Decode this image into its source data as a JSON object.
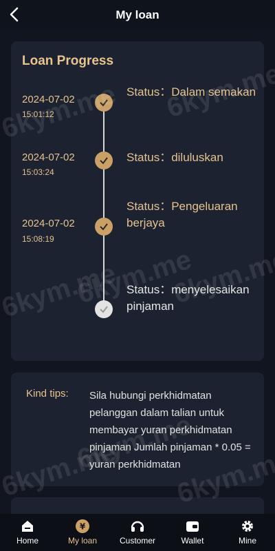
{
  "header": {
    "title": "My loan"
  },
  "progress": {
    "title": "Loan Progress",
    "steps": [
      {
        "date": "2024-07-02",
        "time": "15:01:12",
        "status": "Status：Dalam semakan",
        "done": true
      },
      {
        "date": "2024-07-02",
        "time": "15:03:24",
        "status": "Status：diluluskan",
        "done": true
      },
      {
        "date": "2024-07-02",
        "time": "15:08:19",
        "status": "Status：Pengeluaran berjaya",
        "done": true
      },
      {
        "date": "",
        "time": "",
        "status": "Status：menyelesaikan pinjaman",
        "done": false
      }
    ]
  },
  "tips": {
    "label": "Kind tips:",
    "text": "Sila hubungi perkhidmatan pelanggan dalam talian untuk membayar yuran perkhidmatan pinjaman Jumlah pinjaman * 0.05 = yuran perkhidmatan"
  },
  "nav": {
    "items": [
      {
        "label": "Home",
        "icon": "home-icon"
      },
      {
        "label": "My loan",
        "icon": "loan-icon"
      },
      {
        "label": "Customer",
        "icon": "headset-icon"
      },
      {
        "label": "Wallet",
        "icon": "wallet-icon"
      },
      {
        "label": "Mine",
        "icon": "gear-icon"
      }
    ]
  },
  "watermark": "6kym.me",
  "colors": {
    "accent": "#e6c38e",
    "dot_done": "#caa065",
    "background": "#11151f",
    "card": "#1c2230"
  }
}
